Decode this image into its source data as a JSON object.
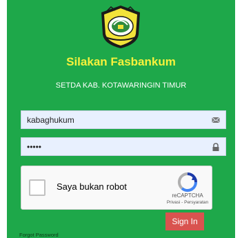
{
  "login": {
    "title": "Silakan Fasbankum",
    "subtitle": "SETDA KAB. KOTAWARINGIN TIMUR",
    "username_value": "kabaghukum",
    "password_value": "•••••",
    "username_icon": "envelope-icon",
    "password_icon": "lock-icon",
    "signin_label": "Sign In",
    "forgot_label": "Forgot Password"
  },
  "captcha": {
    "checkbox_label": "Saya bukan robot",
    "brand": "reCAPTCHA",
    "links": "Privasi - Persyaratan"
  },
  "colors": {
    "panel_bg": "#1ea84a",
    "title": "#f7f23c",
    "signin_bg": "#d9534f",
    "field_bg": "#e8f0fe"
  }
}
